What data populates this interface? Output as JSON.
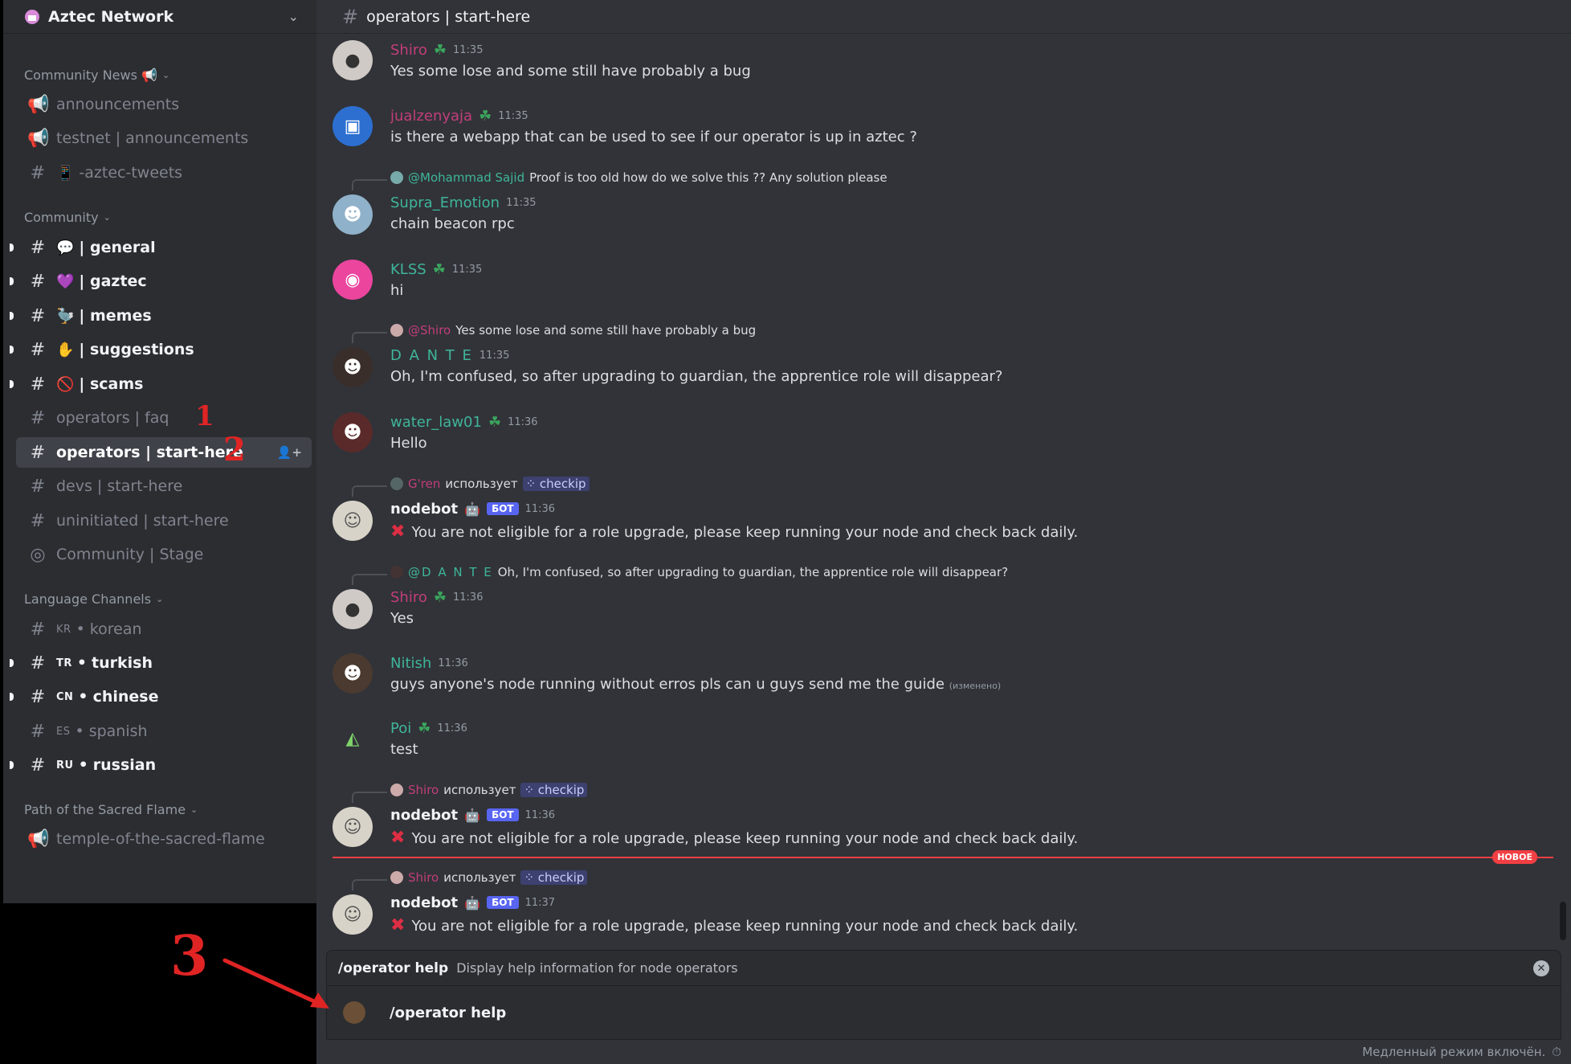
{
  "server": {
    "name": "Aztec Network"
  },
  "categories": {
    "community_news": "Community News 📢",
    "community": "Community",
    "language": "Language Channels",
    "sacred": "Path of the Sacred Flame"
  },
  "channels": {
    "announcements": "announcements",
    "testnet_announcements": "testnet | announcements",
    "aztec_tweets": "-aztec-tweets",
    "general": "| general",
    "gaztec": "| gaztec",
    "memes": "| memes",
    "suggestions": "| suggestions",
    "scams": "| scams",
    "operators_faq": "operators | faq",
    "operators_start": "operators | start-here",
    "devs_start": "devs | start-here",
    "uninitiated_start": "uninitiated | start-here",
    "community_stage": "Community | Stage",
    "korean": "korean",
    "turkish": "turkish",
    "chinese": "chinese",
    "spanish": "spanish",
    "russian": "russian",
    "temple": "temple-of-the-sacred-flame"
  },
  "lang_codes": {
    "kr": "KR",
    "tr": "TR",
    "cn": "CN",
    "es": "ES",
    "ru": "RU"
  },
  "topbar": {
    "title": "operators | start-here"
  },
  "messages": {
    "m1": {
      "user": "Shiro",
      "time": "11:35",
      "text": "Yes some lose and some still have probably a bug"
    },
    "m2": {
      "user": "jualzenyaja",
      "time": "11:35",
      "text": "is there a webapp that can be used to see if our operator is up in aztec ?"
    },
    "m3": {
      "reply_user": "@Mohammad Sajid",
      "reply_text": "Proof is too old how do we solve this ?? Any solution please",
      "user": "Supra_Emotion",
      "time": "11:35",
      "text": "chain beacon rpc"
    },
    "m4": {
      "user": "KLSS",
      "time": "11:35",
      "text": "hi"
    },
    "m5": {
      "reply_user": "@Shiro",
      "reply_text": "Yes some lose and some still have probably a bug",
      "user": "D A N T E",
      "time": "11:35",
      "text": "Oh, I'm confused, so after upgrading to guardian, the apprentice role will disappear?"
    },
    "m6": {
      "user": "water_law01",
      "time": "11:36",
      "text": "Hello"
    },
    "m7": {
      "reply_user": "G'ren",
      "reply_uses": "использует",
      "reply_cmd": "checkip",
      "user": "nodebot",
      "bot": "БОТ",
      "time": "11:36",
      "text": "You are not eligible for a role upgrade, please keep running your node and check back daily."
    },
    "m8": {
      "reply_user": "@D A N T E",
      "reply_text": "Oh, I'm confused, so after upgrading to guardian, the apprentice role will disappear?",
      "user": "Shiro",
      "time": "11:36",
      "text": "Yes"
    },
    "m9": {
      "user": "Nitish",
      "time": "11:36",
      "text": "guys anyone's node running without erros pls can u guys send me the guide",
      "edited": "(изменено)"
    },
    "m10": {
      "user": "Poi",
      "time": "11:36",
      "text": "test"
    },
    "m11": {
      "reply_user": "Shiro",
      "reply_uses": "использует",
      "reply_cmd": "checkip",
      "user": "nodebot",
      "bot": "БОТ",
      "time": "11:36",
      "text": "You are not eligible for a role upgrade, please keep running your node and check back daily."
    },
    "m12": {
      "reply_user": "Shiro",
      "reply_uses": "использует",
      "reply_cmd": "checkip",
      "user": "nodebot",
      "bot": "БОТ",
      "time": "11:37",
      "text": "You are not eligible for a role upgrade, please keep running your node and check back daily."
    }
  },
  "new_badge": "НОВОЕ",
  "command": {
    "name": "/operator help",
    "description": "Display help information for node operators",
    "input": "/operator help"
  },
  "slowmode": "Медленный режим включён.",
  "annotations": {
    "a1": "1",
    "a2": "2",
    "a3": "3"
  },
  "colors": {
    "accent": "#5865f2",
    "unread_divider": "#f23f43",
    "annotation": "#e02424"
  }
}
